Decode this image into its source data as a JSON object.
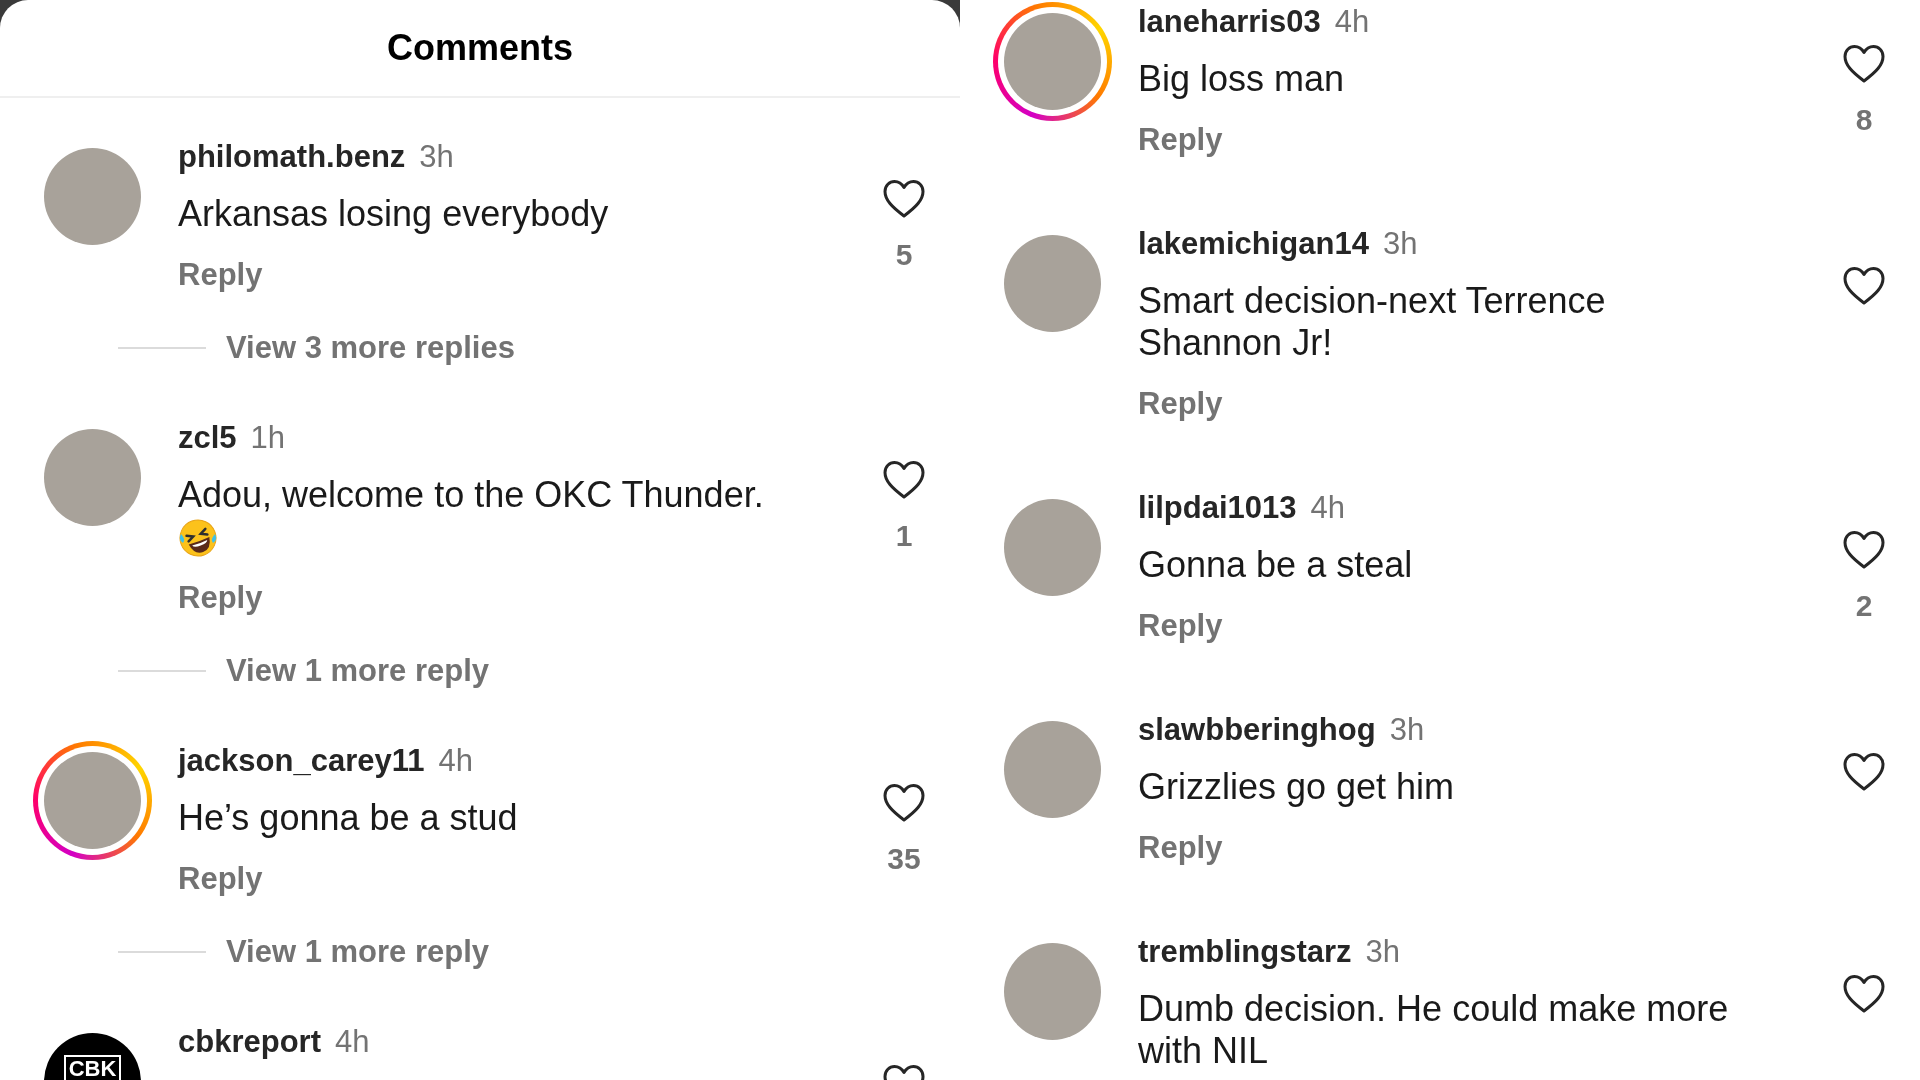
{
  "left_panel": {
    "title": "Comments",
    "comments": [
      {
        "username": "philomath.benz",
        "time": "3h",
        "lines": [
          "Arkansas losing everybody"
        ],
        "has_story": false,
        "reply_label": "Reply",
        "liked": false,
        "likes": "5",
        "view_replies": "View 3 more replies"
      },
      {
        "username": "zcl5",
        "time": "1h",
        "lines": [
          "Adou, welcome to the OKC Thunder."
        ],
        "laughing_emoji": true,
        "has_story": false,
        "reply_label": "Reply",
        "liked": false,
        "likes": "1",
        "view_replies": "View 1 more reply"
      },
      {
        "username": "jackson_carey11",
        "time": "4h",
        "lines": [
          "He’s gonna be a stud"
        ],
        "has_story": true,
        "reply_label": "Reply",
        "liked": false,
        "likes": "35",
        "view_replies": "View 1 more reply"
      },
      {
        "username": "cbkreport",
        "time": "4h",
        "has_story": false,
        "avatar_text": "CBK",
        "liked": false
      }
    ]
  },
  "right_panel": {
    "comments": [
      {
        "username": "laneharris03",
        "time": "4h",
        "lines": [
          "Big loss man"
        ],
        "has_story": true,
        "reply_label": "Reply",
        "liked": false,
        "likes": "8"
      },
      {
        "username": "lakemichigan14",
        "time": "3h",
        "lines": [
          "Smart decision-next Terrence",
          "Shannon Jr!"
        ],
        "has_story": false,
        "reply_label": "Reply",
        "liked": false
      },
      {
        "username": "lilpdai1013",
        "time": "4h",
        "lines": [
          "Gonna be a steal"
        ],
        "has_story": false,
        "reply_label": "Reply",
        "liked": false,
        "likes": "2"
      },
      {
        "username": "slawbberinghog",
        "time": "3h",
        "lines": [
          "Grizzlies go get him"
        ],
        "has_story": false,
        "reply_label": "Reply",
        "liked": false
      },
      {
        "username": "tremblingstarz",
        "time": "3h",
        "lines": [
          "Dumb decision. He could make more",
          "with NIL"
        ],
        "has_story": false,
        "liked": false
      }
    ]
  }
}
